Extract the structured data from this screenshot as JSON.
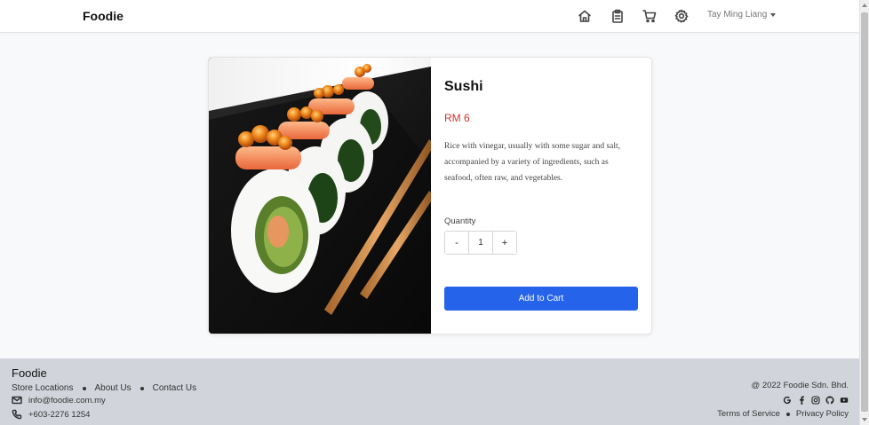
{
  "navbar": {
    "brand": "Foodie",
    "icons": [
      "home-icon",
      "clipboard-icon",
      "cart-icon",
      "gear-icon"
    ],
    "user_name": "Tay Ming Liang"
  },
  "product": {
    "name": "Sushi",
    "price": "RM 6",
    "description": "Rice with vinegar, usually with some sugar and salt, accompanied by a variety of ingredients, such as seafood, often raw, and vegetables.",
    "quantity_label": "Quantity",
    "quantity_value": "1",
    "decrement_label": "-",
    "increment_label": "+",
    "add_to_cart_label": "Add to Cart",
    "accent_color": "#2563eb",
    "price_color": "#d0342c"
  },
  "footer": {
    "brand": "Foodie",
    "links": [
      "Store Locations",
      "About Us",
      "Contact Us"
    ],
    "email": "info@foodie.com.my",
    "phone": "+603-2276 1254",
    "copyright": "@ 2022 Foodie Sdn. Bhd.",
    "socials": [
      "google-icon",
      "facebook-icon",
      "instagram-icon",
      "github-icon",
      "youtube-icon"
    ],
    "terms_label": "Terms of Service",
    "privacy_label": "Privacy Policy"
  }
}
